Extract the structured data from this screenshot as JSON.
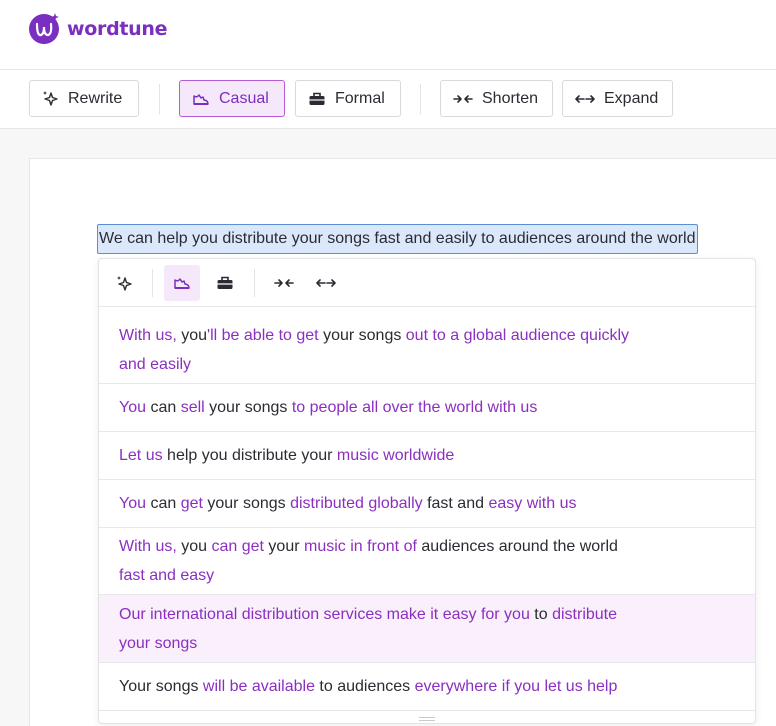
{
  "app": {
    "name": "wordtune"
  },
  "toolbar": {
    "rewrite_label": "Rewrite",
    "casual_label": "Casual",
    "formal_label": "Formal",
    "shorten_label": "Shorten",
    "expand_label": "Expand",
    "active": "casual"
  },
  "document": {
    "selected_text": "We can help you distribute your songs fast and easily to audiences around the world"
  },
  "suggestions": [
    {
      "lines": [
        [
          {
            "t": "With us,",
            "c": true
          },
          {
            "t": " you",
            "c": false
          },
          {
            "t": "'ll be able to get",
            "c": true
          },
          {
            "t": " your songs ",
            "c": false
          },
          {
            "t": "out to a global audience quickly",
            "c": true
          }
        ],
        [
          {
            "t": "and easily",
            "c": true
          }
        ]
      ]
    },
    {
      "lines": [
        [
          {
            "t": "You",
            "c": true
          },
          {
            "t": " can ",
            "c": false
          },
          {
            "t": "sell",
            "c": true
          },
          {
            "t": " your songs ",
            "c": false
          },
          {
            "t": "to people all over the world with us",
            "c": true
          }
        ]
      ]
    },
    {
      "lines": [
        [
          {
            "t": "Let us",
            "c": true
          },
          {
            "t": " help you distribute your ",
            "c": false
          },
          {
            "t": "music worldwide",
            "c": true
          }
        ]
      ]
    },
    {
      "lines": [
        [
          {
            "t": "You",
            "c": true
          },
          {
            "t": " can ",
            "c": false
          },
          {
            "t": "get",
            "c": true
          },
          {
            "t": " your songs ",
            "c": false
          },
          {
            "t": "distributed globally",
            "c": true
          },
          {
            "t": " fast and ",
            "c": false
          },
          {
            "t": "easy with us",
            "c": true
          }
        ]
      ]
    },
    {
      "lines": [
        [
          {
            "t": "With us,",
            "c": true
          },
          {
            "t": " you ",
            "c": false
          },
          {
            "t": "can get",
            "c": true
          },
          {
            "t": " your ",
            "c": false
          },
          {
            "t": "music in front of",
            "c": true
          },
          {
            "t": " audiences around the world",
            "c": false
          }
        ],
        [
          {
            "t": "fast and easy",
            "c": true
          }
        ]
      ]
    },
    {
      "highlighted": true,
      "lines": [
        [
          {
            "t": "Our international distribution services make it easy for you",
            "c": true
          },
          {
            "t": " to ",
            "c": false
          },
          {
            "t": "distribute",
            "c": true
          }
        ],
        [
          {
            "t": "your songs",
            "c": true
          }
        ]
      ]
    },
    {
      "lines": [
        [
          {
            "t": "Your songs ",
            "c": false
          },
          {
            "t": "will be available",
            "c": true
          },
          {
            "t": " to audiences ",
            "c": false
          },
          {
            "t": "everywhere if you let us help",
            "c": true
          }
        ]
      ]
    }
  ],
  "icons": {
    "rewrite": "sparkle-icon",
    "casual": "sneaker-icon",
    "formal": "briefcase-icon",
    "shorten": "shorten-arrows-icon",
    "expand": "expand-arrows-icon"
  },
  "colors": {
    "brand": "#7a2fc0",
    "change_text": "#8b2fc0",
    "active_bg": "#f6e8fb",
    "selection_bg": "#dbe8fb",
    "selection_border": "#5a8fd8"
  }
}
